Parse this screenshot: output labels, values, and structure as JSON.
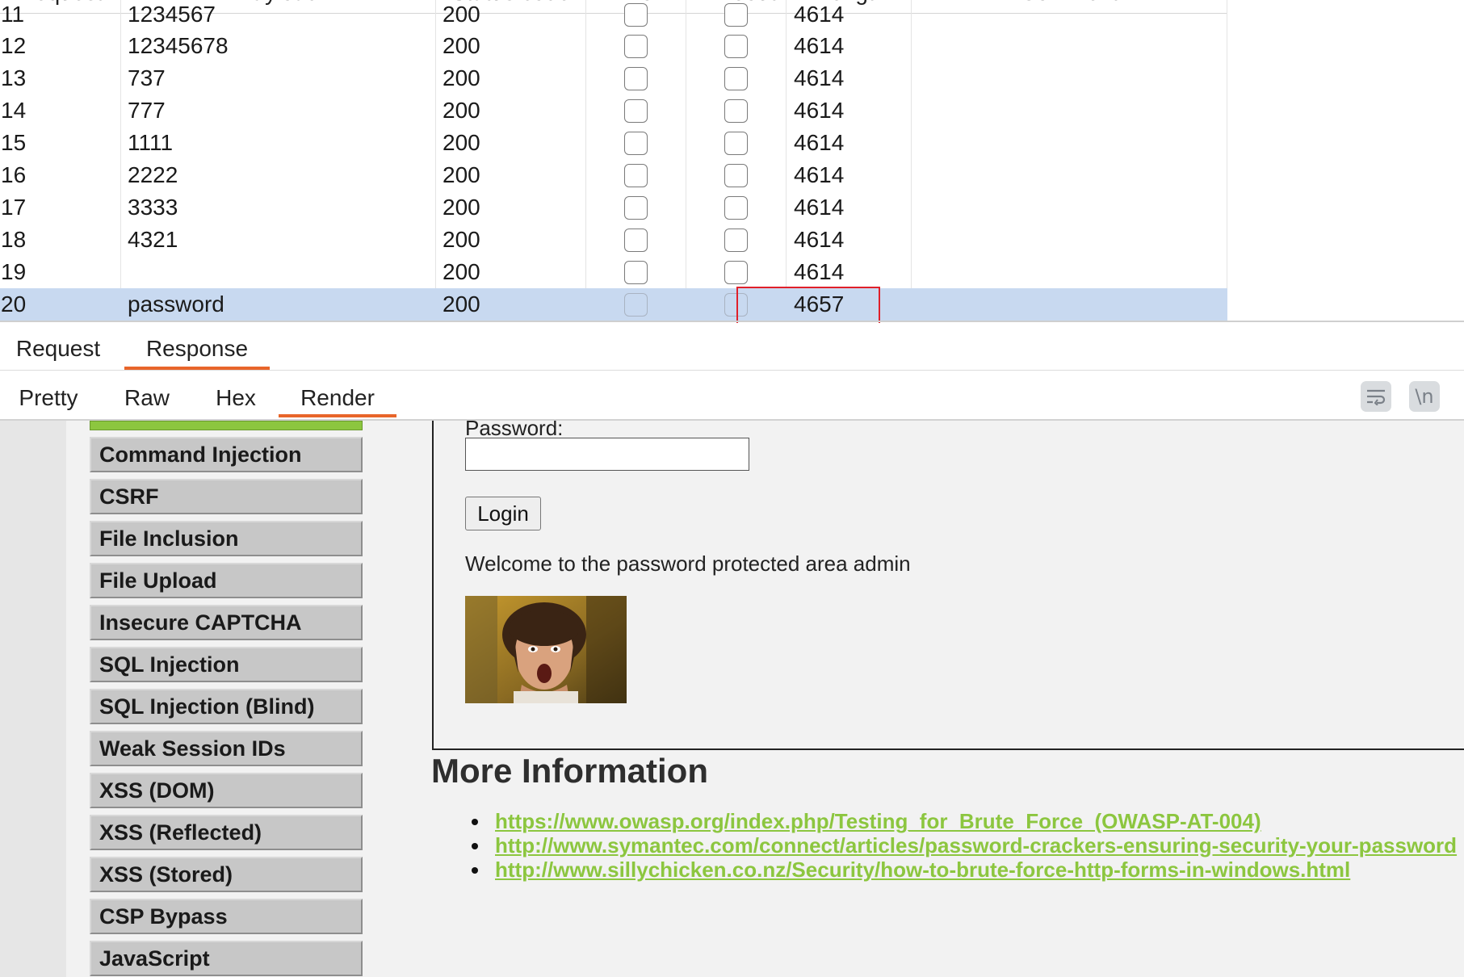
{
  "results": {
    "columns": [
      "Request",
      "Payload",
      "Status code",
      "Error",
      "Timeout",
      "Length",
      "Comment"
    ],
    "rows": [
      {
        "request": "11",
        "payload": "1234567",
        "status": "200",
        "length": "4614"
      },
      {
        "request": "12",
        "payload": "12345678",
        "status": "200",
        "length": "4614"
      },
      {
        "request": "13",
        "payload": "737",
        "status": "200",
        "length": "4614"
      },
      {
        "request": "14",
        "payload": "777",
        "status": "200",
        "length": "4614"
      },
      {
        "request": "15",
        "payload": "1111",
        "status": "200",
        "length": "4614"
      },
      {
        "request": "16",
        "payload": "2222",
        "status": "200",
        "length": "4614"
      },
      {
        "request": "17",
        "payload": "3333",
        "status": "200",
        "length": "4614"
      },
      {
        "request": "18",
        "payload": "4321",
        "status": "200",
        "length": "4614"
      },
      {
        "request": "19",
        "payload": "",
        "status": "200",
        "length": "4614"
      },
      {
        "request": "20",
        "payload": "password",
        "status": "200",
        "length": "4657",
        "selected": true
      }
    ],
    "highlight_color": "#e0202a",
    "selected_row_color": "#c8d9f0"
  },
  "message_tabs": {
    "request": "Request",
    "response": "Response",
    "active": "Response"
  },
  "view_tabs": {
    "pretty": "Pretty",
    "raw": "Raw",
    "hex": "Hex",
    "render": "Render",
    "active": "Render",
    "tools": [
      "wrap-lines-icon",
      "newline-icon"
    ],
    "newline_label": "\\n"
  },
  "accent_color": "#e8652a",
  "rendered_page": {
    "menu": [
      "Command Injection",
      "CSRF",
      "File Inclusion",
      "File Upload",
      "Insecure CAPTCHA",
      "SQL Injection",
      "SQL Injection (Blind)",
      "Weak Session IDs",
      "XSS (DOM)",
      "XSS (Reflected)",
      "XSS (Stored)",
      "CSP Bypass",
      "JavaScript"
    ],
    "password_label": "Password:",
    "password_value": "",
    "login_button": "Login",
    "welcome_text": "Welcome to the password protected area admin",
    "more_info_heading": "More Information",
    "links": [
      "https://www.owasp.org/index.php/Testing_for_Brute_Force_(OWASP-AT-004)",
      "http://www.symantec.com/connect/articles/password-crackers-ensuring-security-your-password",
      "http://www.sillychicken.co.nz/Security/how-to-brute-force-http-forms-in-windows.html"
    ],
    "link_color": "#8cc63f",
    "menu_selected_color": "#8cc63f"
  }
}
